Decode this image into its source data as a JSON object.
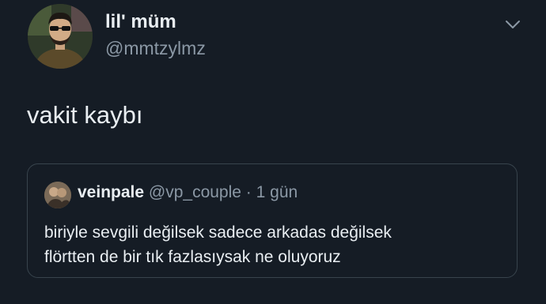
{
  "user": {
    "display_name": "lil' müm",
    "handle": "@mmtzylmz",
    "avatar_icon": "user-avatar-photo"
  },
  "tweet": {
    "text": "vakit kaybı"
  },
  "menu": {
    "icon": "chevron-down-icon"
  },
  "quoted_tweet": {
    "display_name": "veinpale",
    "handle": "@vp_couple",
    "separator": "·",
    "time": "1 gün",
    "avatar_icon": "user-avatar-photo",
    "lines": [
      "biriyle sevgili değilsek sadece arkadas değilsek",
      "flörtten de bir tık fazlasıysak ne oluyoruz"
    ]
  },
  "colors": {
    "background": "#151c25",
    "primary_text": "#e9eef2",
    "secondary_text": "#8b98a5",
    "border": "#38444d"
  }
}
